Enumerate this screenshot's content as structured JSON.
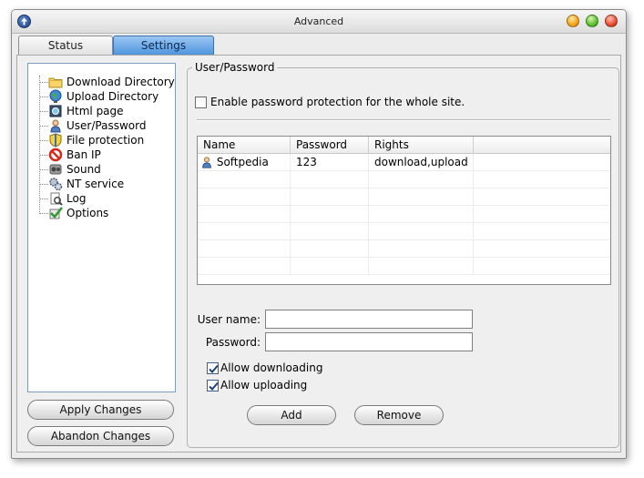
{
  "window": {
    "title": "Advanced"
  },
  "tabs": [
    {
      "label": "Status",
      "active": false
    },
    {
      "label": "Settings",
      "active": true
    }
  ],
  "tree": {
    "items": [
      {
        "label": "Download Directory",
        "icon": "folder-icon"
      },
      {
        "label": "Upload Directory",
        "icon": "globe-icon"
      },
      {
        "label": "Html page",
        "icon": "html-page-icon"
      },
      {
        "label": "User/Password",
        "icon": "user-icon"
      },
      {
        "label": "File protection",
        "icon": "shield-icon"
      },
      {
        "label": "Ban IP",
        "icon": "ban-icon"
      },
      {
        "label": "Sound",
        "icon": "sound-icon"
      },
      {
        "label": "NT service",
        "icon": "gears-icon"
      },
      {
        "label": "Log",
        "icon": "log-icon"
      },
      {
        "label": "Options",
        "icon": "checkmark-icon"
      }
    ],
    "selected": "User/Password"
  },
  "left_buttons": {
    "apply": "Apply Changes",
    "abandon": "Abandon Changes"
  },
  "panel": {
    "legend": "User/Password",
    "enable_protection": {
      "label": "Enable password protection for the whole site.",
      "checked": false
    },
    "table": {
      "columns": [
        "Name",
        "Password",
        "Rights"
      ],
      "rows": [
        {
          "name": "Softpedia",
          "password": "123",
          "rights": "download,upload"
        }
      ]
    },
    "username": {
      "label": "User name:",
      "value": ""
    },
    "password": {
      "label": "Password:",
      "value": ""
    },
    "allow_downloading": {
      "label": "Allow downloading",
      "checked": true
    },
    "allow_uploading": {
      "label": "Allow uploading",
      "checked": true
    },
    "add_label": "Add",
    "remove_label": "Remove"
  },
  "colors": {
    "active_tab": "#4f95dd",
    "window_bg": "#ececec"
  }
}
